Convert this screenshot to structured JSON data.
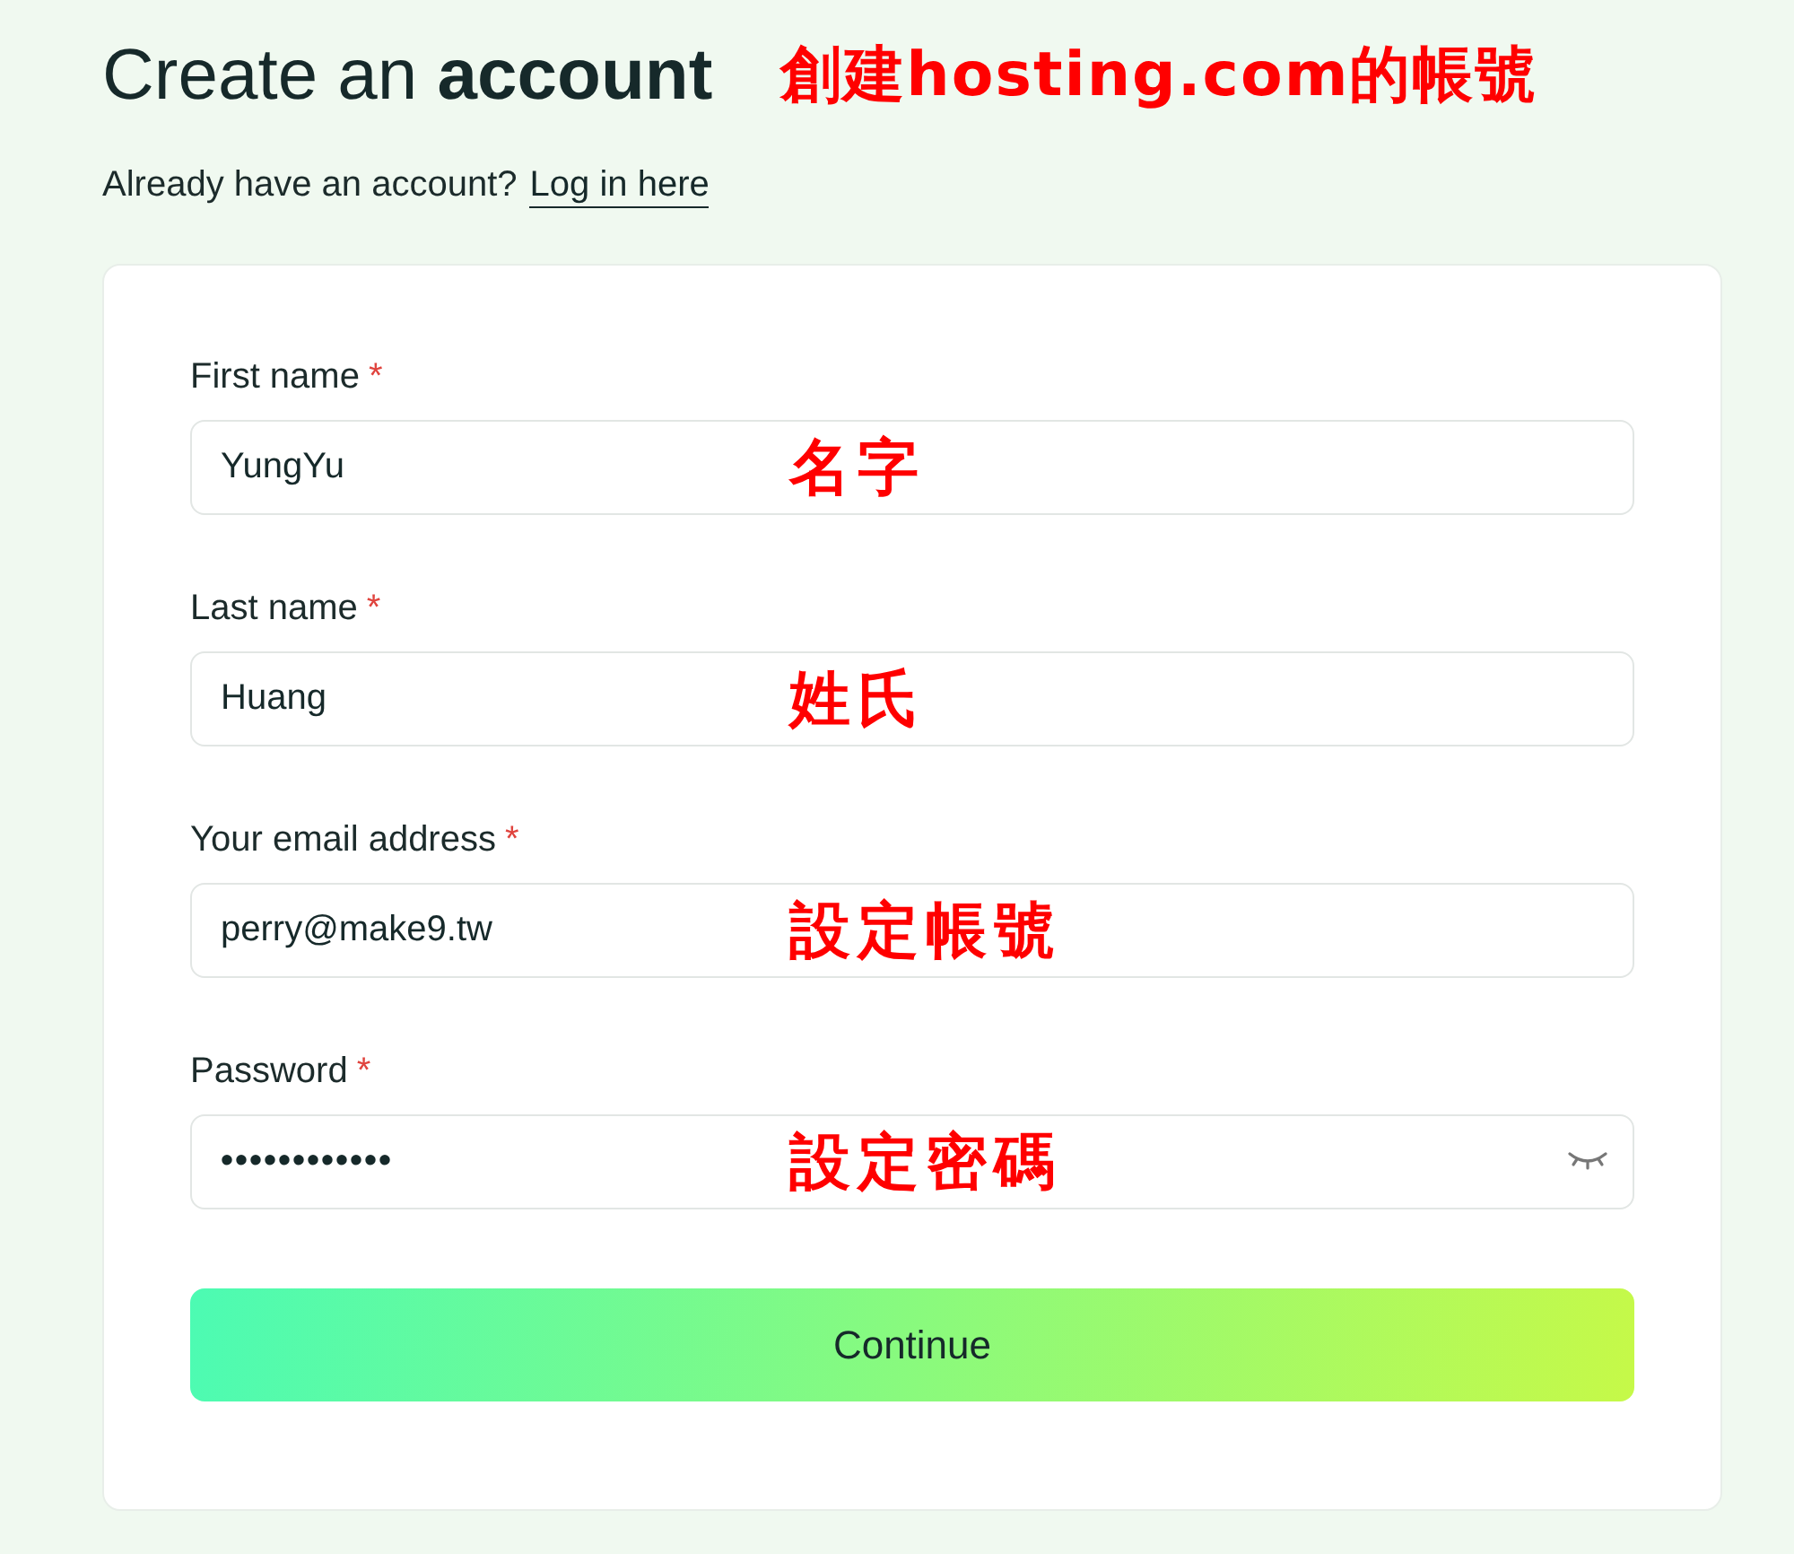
{
  "header": {
    "title": "Create an **account**",
    "annotation": "創建hosting.com的帳號",
    "subtitle": "Already have an account?",
    "login_link": "Log in here"
  },
  "fields": [
    {
      "kind": "text",
      "label": "First name",
      "required": "*",
      "value": "YungYu",
      "annotation": "名字"
    },
    {
      "kind": "text",
      "label": "Last name",
      "required": "*",
      "value": "Huang",
      "annotation": "姓氏"
    },
    {
      "kind": "text",
      "label": "Your email address",
      "required": "*",
      "value": "perry@make9.tw",
      "annotation": "設定帳號"
    },
    {
      "kind": "password",
      "label": "Password",
      "required": "*",
      "value": "••••••••••••",
      "annotation": "設定密碼"
    }
  ],
  "continue_button": "Continue"
}
